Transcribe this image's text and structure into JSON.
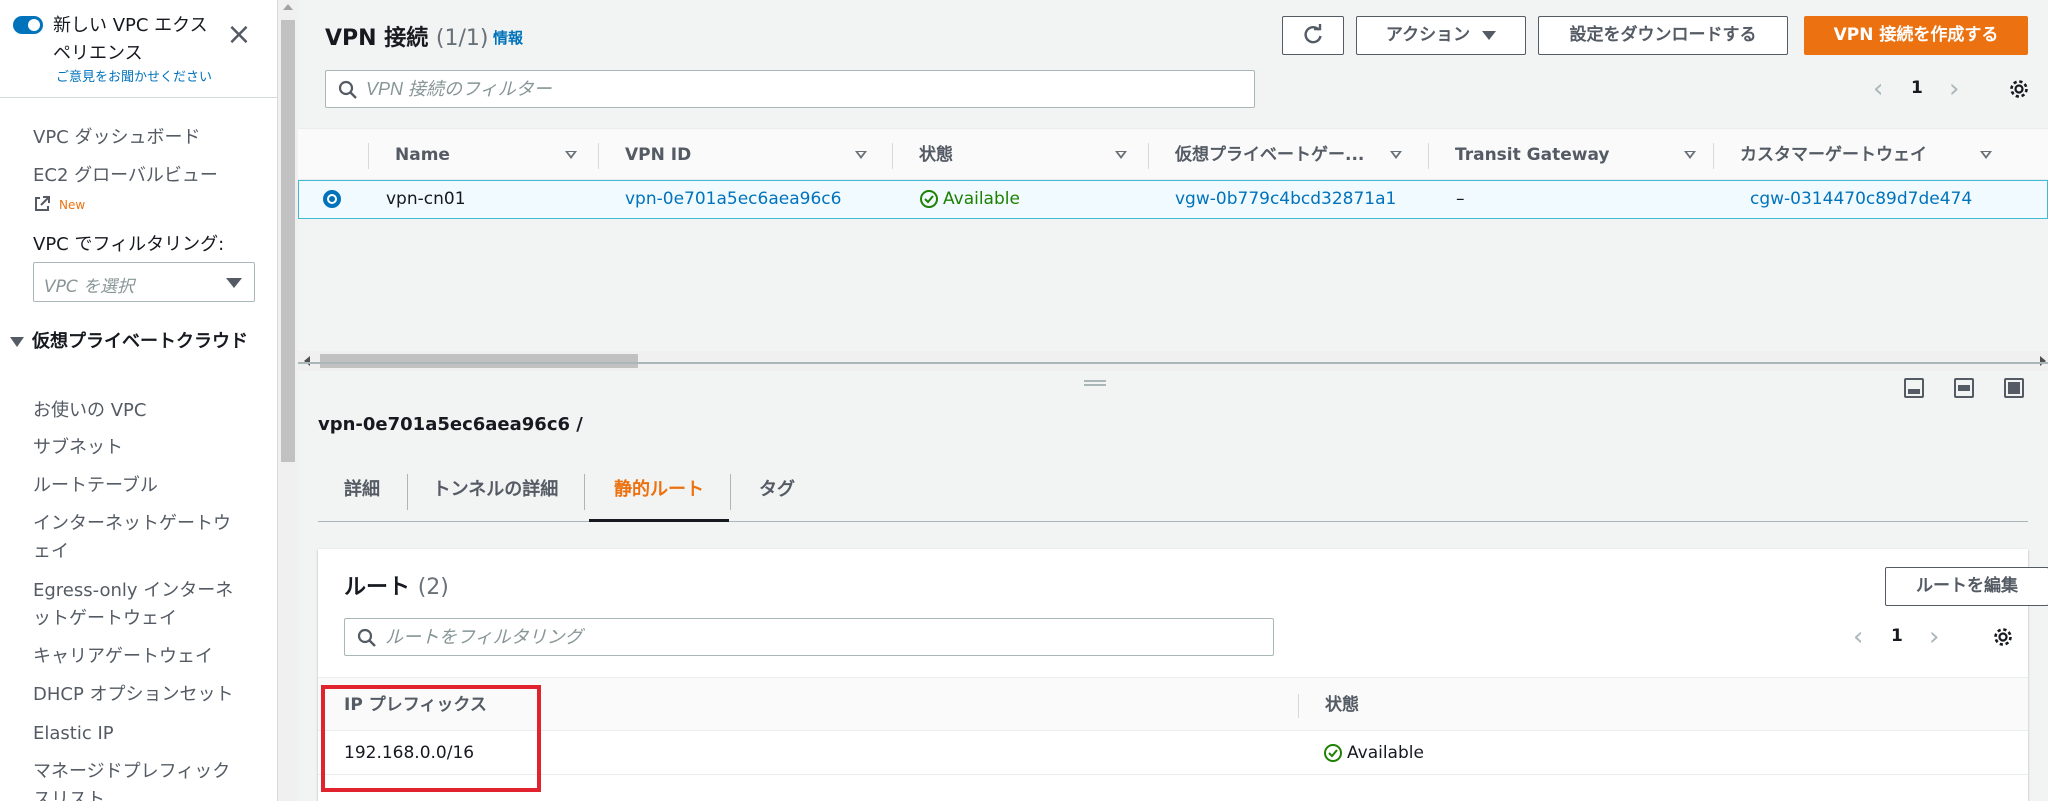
{
  "sidebar": {
    "experience_label": "新しい VPC エクスペリエンス",
    "feedback_link": "ご意見をお聞かせください",
    "items": [
      {
        "label": "VPC ダッシュボード"
      },
      {
        "label": "EC2 グローバルビュー"
      }
    ],
    "new_badge": "New",
    "filter_label": "VPC でフィルタリング:",
    "filter_placeholder": "VPC を選択",
    "section_title": "仮想プライベートクラウド",
    "section_items": [
      {
        "label": "お使いの VPC"
      },
      {
        "label": "サブネット"
      },
      {
        "label": "ルートテーブル"
      },
      {
        "label": "インターネットゲートウェイ"
      },
      {
        "label": "Egress-only インターネットゲートウェイ"
      },
      {
        "label": "キャリアゲートウェイ"
      },
      {
        "label": "DHCP オプションセット"
      },
      {
        "label": "Elastic IP"
      },
      {
        "label": "マネージドプレフィックスリスト"
      }
    ]
  },
  "header": {
    "title": "VPN 接続",
    "count": "(1/1)",
    "info_link": "情報",
    "actions_label": "アクション",
    "download_label": "設定をダウンロードする",
    "create_label": "VPN 接続を作成する",
    "filter_placeholder": "VPN 接続のフィルター",
    "page_number": "1"
  },
  "table": {
    "columns": [
      "Name",
      "VPN ID",
      "状態",
      "仮想プライベートゲー...",
      "Transit Gateway",
      "カスタマーゲートウェイ"
    ],
    "row": {
      "name": "vpn-cn01",
      "vpn_id": "vpn-0e701a5ec6aea96c6",
      "state": "Available",
      "vgw": "vgw-0b779c4bcd32871a1",
      "transit_gateway": "–",
      "cgw": "cgw-0314470c89d7de474"
    }
  },
  "detail": {
    "title": "vpn-0e701a5ec6aea96c6 /",
    "tabs": [
      "詳細",
      "トンネルの詳細",
      "静的ルート",
      "タグ"
    ],
    "active_tab": "静的ルート",
    "routes": {
      "title": "ルート",
      "count": "(2)",
      "edit_label": "ルートを編集",
      "filter_placeholder": "ルートをフィルタリング",
      "page_number": "1",
      "columns": [
        "IP プレフィックス",
        "状態"
      ],
      "rows": [
        {
          "prefix": "192.168.0.0/16",
          "state": "Available"
        }
      ]
    }
  },
  "colors": {
    "accent": "#ec7211",
    "link": "#0073bb",
    "success": "#1d8102",
    "highlight": "#e0232e"
  }
}
